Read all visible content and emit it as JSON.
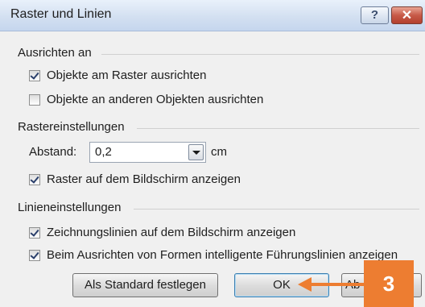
{
  "window": {
    "title": "Raster und Linien",
    "help_label": "?",
    "close_label": "✕"
  },
  "snap_section": {
    "label": "Ausrichten an",
    "options": [
      {
        "label": "Objekte am Raster ausrichten",
        "checked": true
      },
      {
        "label": "Objekte an anderen Objekten ausrichten",
        "checked": false
      }
    ]
  },
  "grid_section": {
    "label": "Rastereinstellungen",
    "spacing_label": "Abstand:",
    "spacing_value": "0,2",
    "spacing_unit": "cm",
    "show_grid_label": "Raster auf dem Bildschirm anzeigen",
    "show_grid_checked": true
  },
  "guide_section": {
    "label": "Linieneinstellungen",
    "options": [
      {
        "label": "Zeichnungslinien auf dem Bildschirm anzeigen",
        "checked": true
      },
      {
        "label": "Beim Ausrichten von Formen intelligente Führungslinien anzeigen",
        "checked": true
      }
    ]
  },
  "buttons": {
    "default_label": "Als Standard festlegen",
    "ok_label": "OK",
    "abort_partial_label": "Ab"
  },
  "annotation": {
    "step_number": "3",
    "color": "#ed7d31"
  }
}
